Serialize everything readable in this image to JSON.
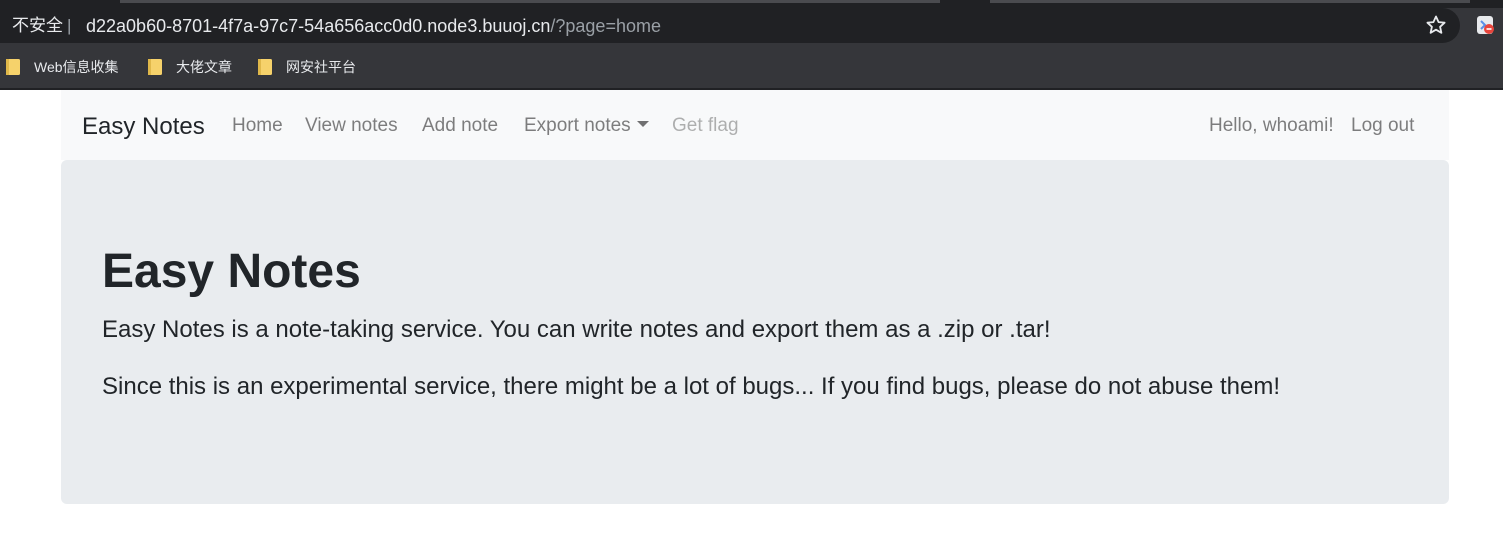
{
  "browser": {
    "security_label": "不安全",
    "separator": "|",
    "url_host": "d22a0b60-8701-4f7a-97c7-54a656acc0d0.node3.buuoj.cn",
    "url_path": "/?page=home",
    "bookmarks": [
      {
        "label": "Web信息收集"
      },
      {
        "label": "大佬文章"
      },
      {
        "label": "网安社平台"
      }
    ]
  },
  "navbar": {
    "brand": "Easy Notes",
    "links": {
      "home": "Home",
      "view_notes": "View notes",
      "add_note": "Add note",
      "export_notes": "Export notes",
      "get_flag": "Get flag"
    },
    "greeting": "Hello, whoami!",
    "logout": "Log out"
  },
  "jumbotron": {
    "title": "Easy Notes",
    "lead1": "Easy Notes is a note-taking service. You can write notes and export them as a .zip or .tar!",
    "lead2": "Since this is an experimental service, there might be a lot of bugs... If you find bugs, please do not abuse them!"
  },
  "colors": {
    "chrome_bg": "#35363a",
    "omnibox_bg": "#202124",
    "navbar_bg": "#f8f9fa",
    "jumbotron_bg": "#e9ecef",
    "folder_yellow": "#f6d26b"
  }
}
